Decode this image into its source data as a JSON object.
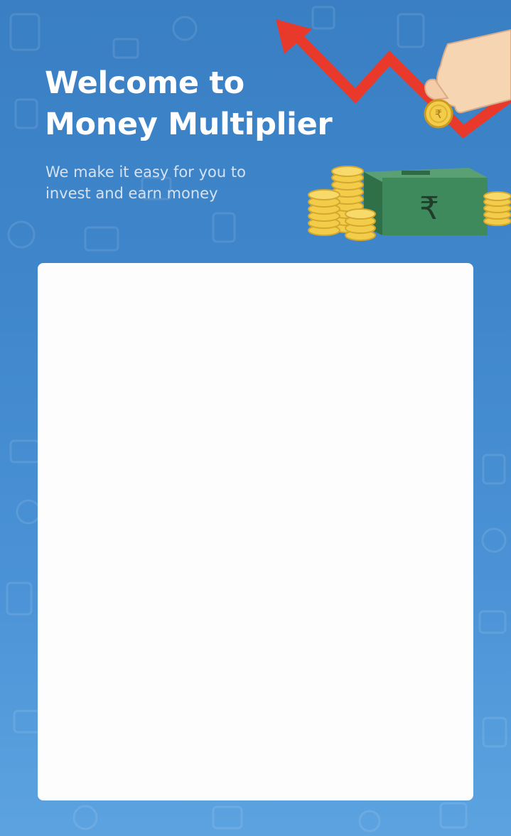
{
  "header": {
    "title_line1": "Welcome to",
    "title_line2": "Money Multiplier",
    "subtitle_line1": "We make it easy for you to",
    "subtitle_line2": "invest and earn money"
  },
  "hero_illustration": {
    "icons": [
      "trend-arrow-icon",
      "hand-icon",
      "rupee-coin-icon",
      "coin-stack-icon",
      "rupee-cash-box-icon"
    ],
    "currency_symbol": "₹"
  },
  "theme": {
    "background_top": "#3a7fc3",
    "background_bottom": "#5ca3e0",
    "arrow_color": "#e8392b",
    "box_color": "#3f8a5c",
    "coin_color": "#f3cd4a",
    "card_color": "#fdfdfe"
  }
}
